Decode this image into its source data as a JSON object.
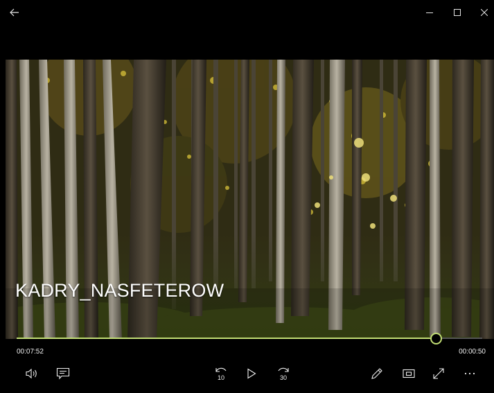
{
  "titlebar": {
    "back_icon": "back-arrow-icon",
    "minimize_icon": "minimize-icon",
    "maximize_icon": "maximize-icon",
    "close_icon": "close-icon"
  },
  "video": {
    "title": "KADRY_NASFETEROW"
  },
  "playback": {
    "elapsed": "00:07:52",
    "remaining": "00:00:50",
    "progress_fraction": 0.9,
    "accent_color": "#c3df75"
  },
  "controls": {
    "volume_icon": "volume-icon",
    "subtitles_icon": "subtitles-icon",
    "skip_back_label": "10",
    "play_icon": "play-icon",
    "skip_forward_label": "30",
    "edit_icon": "pencil-icon",
    "mini_view_icon": "mini-view-icon",
    "fullscreen_icon": "fullscreen-icon",
    "more_icon": "more-icon"
  }
}
